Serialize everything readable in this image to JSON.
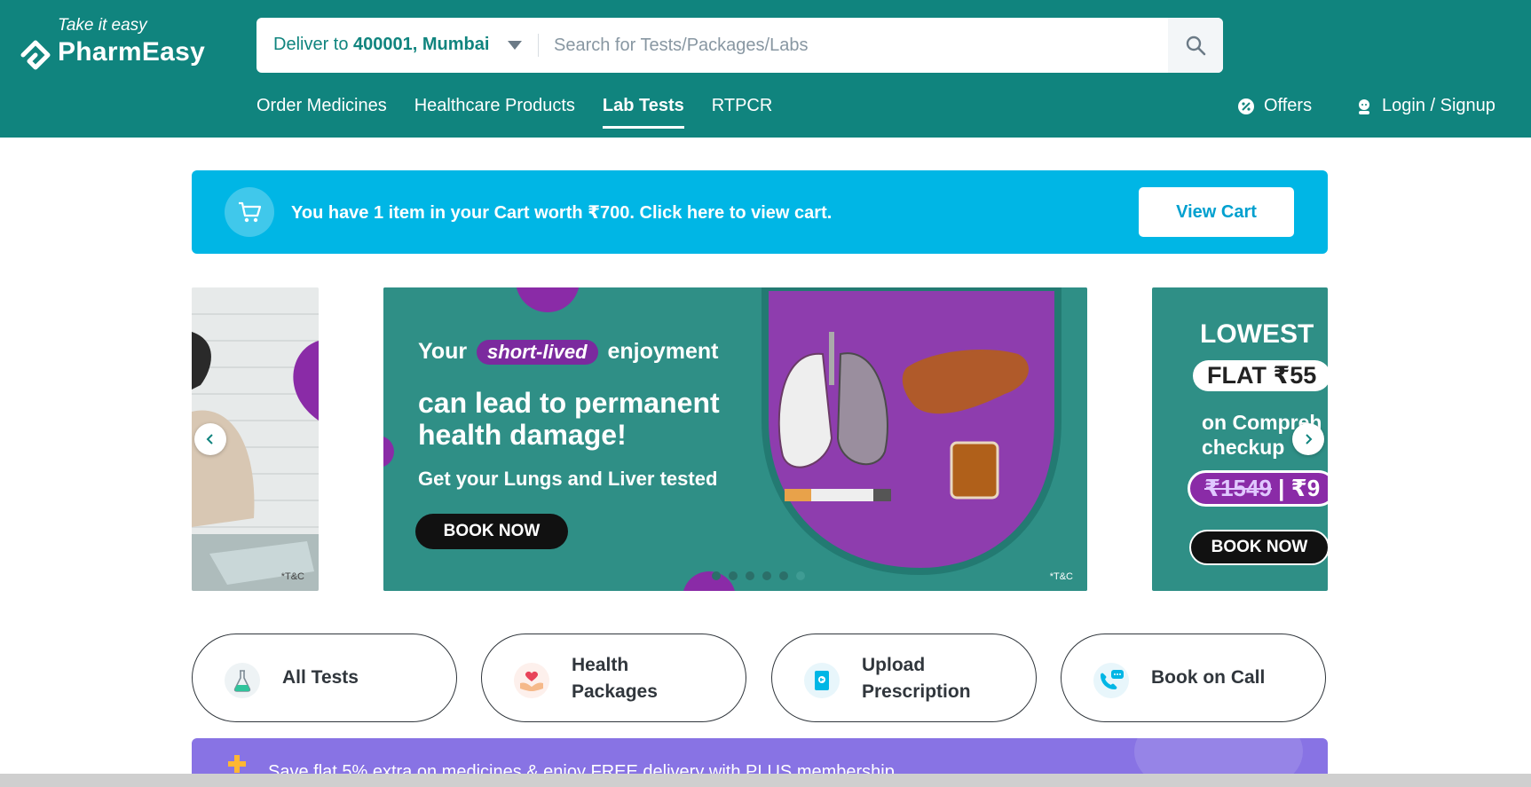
{
  "header": {
    "tagline": "Take it easy",
    "brand": "PharmEasy",
    "deliver_prefix": "Deliver to",
    "deliver_location": "400001, Mumbai",
    "search_placeholder": "Search for Tests/Packages/Labs",
    "nav": [
      {
        "label": "Order Medicines",
        "active": false
      },
      {
        "label": "Healthcare Products",
        "active": false
      },
      {
        "label": "Lab Tests",
        "active": true
      },
      {
        "label": "RTPCR",
        "active": false
      }
    ],
    "offers_label": "Offers",
    "login_label": "Login / Signup"
  },
  "cart_banner": {
    "text": "You have 1 item in your Cart worth ₹700. Click here to view cart.",
    "button_label": "View Cart"
  },
  "carousel": {
    "center": {
      "line1_prefix": "Your",
      "line1_highlight": "short-lived",
      "line1_suffix": "enjoyment",
      "headline": "can lead to permanent health damage!",
      "subline": "Get your Lungs and Liver tested",
      "button": "BOOK NOW",
      "tc": "*T&C"
    },
    "left": {
      "tc": "*T&C"
    },
    "right": {
      "lowest": "LOWEST",
      "flat": "FLAT ₹55",
      "on": "on Compreh",
      "checkup": "checkup",
      "price_old": "₹1549",
      "price_sep": " | ₹9",
      "button": "BOOK NOW"
    },
    "dot_count": 6
  },
  "quick_links": [
    {
      "label_line1": "All Tests",
      "label_line2": ""
    },
    {
      "label_line1": "Health",
      "label_line2": "Packages"
    },
    {
      "label_line1": "Upload",
      "label_line2": "Prescription"
    },
    {
      "label_line1": "Book on Call",
      "label_line2": ""
    }
  ],
  "plus_banner": {
    "text": "Save flat 5% extra on medicines & enjoy FREE delivery with PLUS membership"
  },
  "colors": {
    "header": "#10847e",
    "cart_banner": "#00b6e5",
    "carousel_teal": "#2f8f86",
    "purple": "#8a2ba7",
    "plus_banner": "#8873e4"
  }
}
